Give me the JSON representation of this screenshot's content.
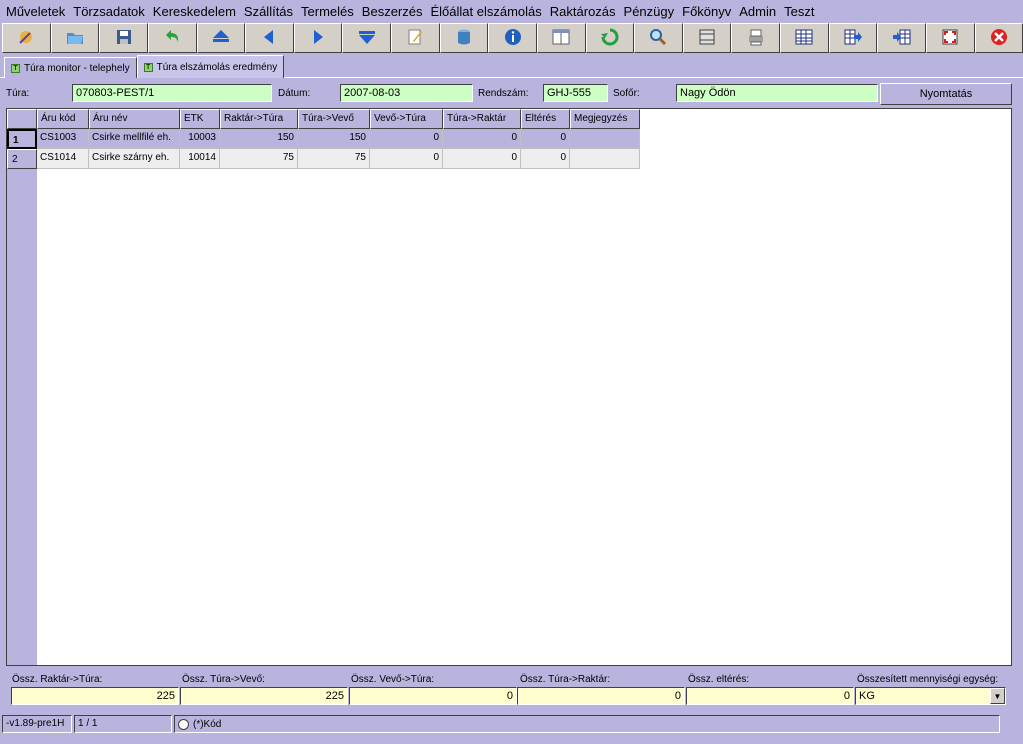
{
  "menu": [
    "Műveletek",
    "Törzsadatok",
    "Kereskedelem",
    "Szállítás",
    "Termelés",
    "Beszerzés",
    "Élőállat elszámolás",
    "Raktározás",
    "Pénzügy",
    "Főkönyv",
    "Admin",
    "Teszt"
  ],
  "toolbar": {
    "icons": [
      "wizard-icon",
      "open-icon",
      "save-icon",
      "undo-icon",
      "first-icon",
      "prev-icon",
      "next-icon",
      "last-icon",
      "edit-icon",
      "database-icon",
      "info-icon",
      "window-icon",
      "refresh-icon",
      "search-icon",
      "filter-icon",
      "print-setup-icon",
      "grid-icon",
      "export-icon",
      "import-icon",
      "fullscreen-icon",
      "close-icon"
    ]
  },
  "tabs": [
    {
      "label": "Túra monitor - telephely",
      "icon": "T"
    },
    {
      "label": "Túra elszámolás eredmény",
      "icon": "T",
      "active": true
    }
  ],
  "header": {
    "tura_label": "Túra:",
    "tura_value": "070803-PEST/1",
    "datum_label": "Dátum:",
    "datum_value": "2007-08-03",
    "rendszam_label": "Rendszám:",
    "rendszam_value": "GHJ-555",
    "sofor_label": "Sofőr:",
    "sofor_value": "Nagy Ödön",
    "print_button": "Nyomtatás"
  },
  "grid": {
    "columns": [
      "Áru kód",
      "Áru név",
      "ETK",
      "Raktár->Túra",
      "Túra->Vevő",
      "Vevő->Túra",
      "Túra->Raktár",
      "Eltérés",
      "Megjegyzés"
    ],
    "rows": [
      {
        "num": "1",
        "cells": [
          "CS1003",
          "Csirke mellfilé eh.",
          "10003",
          "150",
          "150",
          "0",
          "0",
          "0",
          ""
        ]
      },
      {
        "num": "2",
        "cells": [
          "CS1014",
          "Csirke szárny eh.",
          "10014",
          "75",
          "75",
          "0",
          "0",
          "0",
          ""
        ]
      }
    ]
  },
  "totals": {
    "raktar_tura_label": "Össz. Raktár->Túra:",
    "raktar_tura_value": "225",
    "tura_vevo_label": "Össz. Túra->Vevő:",
    "tura_vevo_value": "225",
    "vevo_tura_label": "Össz. Vevő->Túra:",
    "vevo_tura_value": "0",
    "tura_raktar_label": "Össz. Túra->Raktár:",
    "tura_raktar_value": "0",
    "elteres_label": "Össz. eltérés:",
    "elteres_value": "0",
    "unit_label": "Összesített mennyiségi egység:",
    "unit_value": "KG"
  },
  "status": {
    "version": "-v1.89-pre1H",
    "record": "1 / 1",
    "mode": "(*)Kód"
  },
  "colors": {
    "background": "#b8b4de",
    "input_green": "#cdfec4",
    "input_yellow": "#fefecf"
  }
}
